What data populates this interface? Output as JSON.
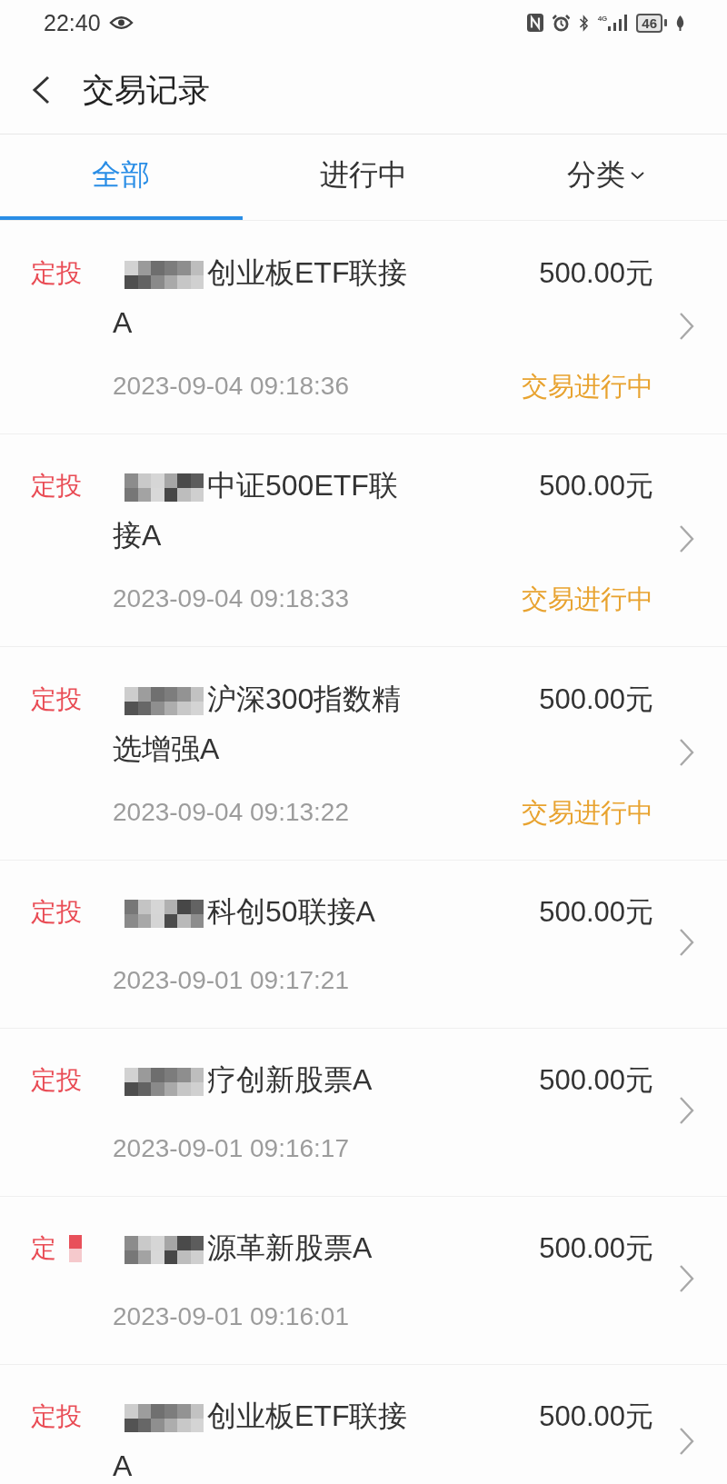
{
  "status_bar": {
    "time": "22:40",
    "network": "4G",
    "battery": "46"
  },
  "header": {
    "title": "交易记录"
  },
  "tabs": [
    {
      "label": "全部",
      "selected": true,
      "kind": "plain"
    },
    {
      "label": "进行中",
      "selected": false,
      "kind": "plain"
    },
    {
      "label": "分类",
      "selected": false,
      "kind": "dropdown"
    }
  ],
  "transactions": [
    {
      "tag": "定投",
      "tag_redacted": false,
      "name_redacted": true,
      "name": "创业板ETF联接A",
      "amount": "500.00元",
      "date": "2023-09-04 09:18:36",
      "status": "交易进行中"
    },
    {
      "tag": "定投",
      "tag_redacted": false,
      "name_redacted": true,
      "name": "中证500ETF联接A",
      "amount": "500.00元",
      "date": "2023-09-04 09:18:33",
      "status": "交易进行中"
    },
    {
      "tag": "定投",
      "tag_redacted": false,
      "name_redacted": true,
      "name": "沪深300指数精选增强A",
      "amount": "500.00元",
      "date": "2023-09-04 09:13:22",
      "status": "交易进行中"
    },
    {
      "tag": "定投",
      "tag_redacted": false,
      "name_redacted": true,
      "name": "科创50联接A",
      "amount": "500.00元",
      "date": "2023-09-01 09:17:21"
    },
    {
      "tag": "定投",
      "tag_redacted": false,
      "name_redacted": true,
      "name": "疗创新股票A",
      "amount": "500.00元",
      "date": "2023-09-01 09:16:17"
    },
    {
      "tag": "定",
      "tag_redacted": true,
      "name_redacted": true,
      "name": "源革新股票A",
      "amount": "500.00元",
      "date": "2023-09-01 09:16:01"
    },
    {
      "tag": "定投",
      "tag_redacted": false,
      "name_redacted": true,
      "name": "创业板ETF联接A",
      "amount": "500.00元"
    }
  ]
}
